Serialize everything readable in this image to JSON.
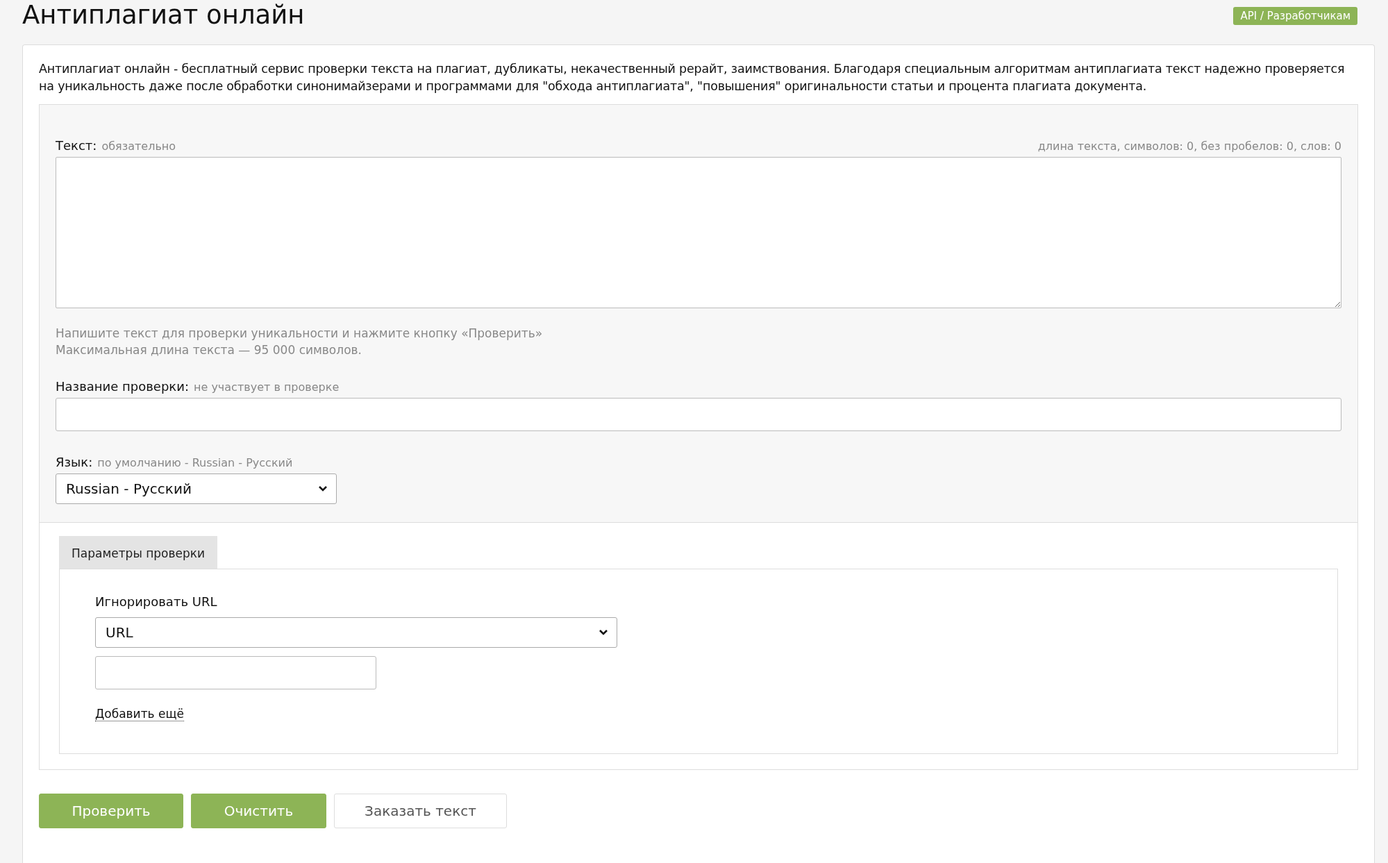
{
  "header": {
    "title": "Антиплагиат онлайн",
    "api_link": "API / Разработчикам"
  },
  "intro": "Антиплагиат онлайн - бесплатный сервис проверки текста на плагиат, дубликаты, некачественный рерайт, заимствования. Благодаря специальным алгоритмам антиплагиата текст надежно проверяется на уникальность даже после обработки синонимайзерами и программами для \"обхода антиплагиата\", \"повышения\" оригинальности статьи и процента плагиата документа.",
  "form": {
    "text_field": {
      "label": "Текст:",
      "note": "обязательно",
      "counter": "длина текста, символов: 0, без пробелов: 0, слов: 0"
    },
    "hints": [
      "Напишите текст для проверки уникальности и нажмите кнопку «Проверить»",
      "Максимальная длина текста — 95 000 символов."
    ],
    "name_field": {
      "label": "Название проверки:",
      "note": "не участвует в проверке"
    },
    "language_field": {
      "label": "Язык:",
      "note": "по умолчанию - Russian - Русский",
      "value": "Russian - Русский"
    }
  },
  "params": {
    "tabs": [
      {
        "label": "Параметры проверки",
        "selected": true
      }
    ],
    "ignore_url": {
      "label": "Игнорировать URL",
      "select_value": "URL"
    },
    "add_more": "Добавить ещё"
  },
  "buttons": [
    {
      "label": "Проверить",
      "kind": "primary"
    },
    {
      "label": "Очистить",
      "kind": "primary"
    },
    {
      "label": "Заказать текст",
      "kind": "secondary"
    }
  ]
}
